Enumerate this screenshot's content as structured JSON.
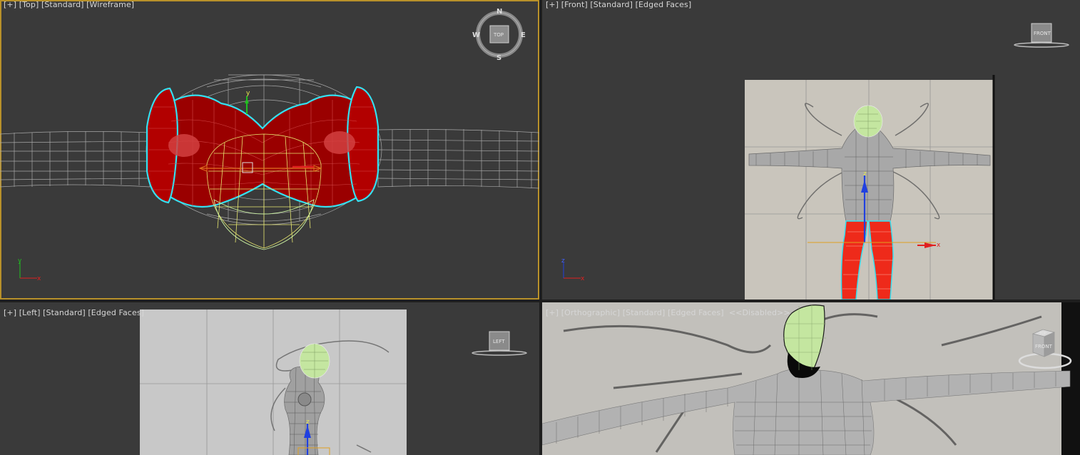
{
  "viewports": [
    {
      "id": "top",
      "label": "[+] [Top] [Standard] [Wireframe]",
      "active": true,
      "viewcube": {
        "face": "TOP",
        "compass": {
          "n": "N",
          "s": "S",
          "e": "E",
          "w": "W"
        }
      },
      "gizmo_axes": {
        "a": "y",
        "b": "x"
      },
      "tripod": {
        "a": "y",
        "b": "x"
      }
    },
    {
      "id": "front",
      "label": "[+] [Front] [Standard] [Edged Faces]",
      "active": false,
      "viewcube": {
        "face": "FRONT"
      },
      "gizmo_axes": {
        "a": "z",
        "b": "x"
      },
      "tripod": {
        "a": "z",
        "b": "x"
      }
    },
    {
      "id": "left",
      "label": "[+] [Left] [Standard] [Edged Faces]",
      "active": false,
      "viewcube": {
        "face": "LEFT"
      },
      "gizmo_axes": {
        "a": "z"
      },
      "tripod": {
        "a": "z",
        "b": "y"
      }
    },
    {
      "id": "ortho",
      "label": "[+] [Orthographic] [Standard] [Edged Faces]  <<Disabled>>",
      "active": false,
      "viewcube": {
        "face1": "TOP",
        "face2": "FRONT"
      }
    }
  ],
  "colors": {
    "viewport_bg": "#3a3a3a",
    "active_border": "#b8912a",
    "selection_outline": "#34e0f0",
    "selected_mesh": "#9a0000",
    "head_mesh": "#c4e6a0",
    "wire": "#bdbdbd",
    "axis_x": "#e02020",
    "axis_y": "#20c020",
    "axis_z": "#2040e0"
  }
}
